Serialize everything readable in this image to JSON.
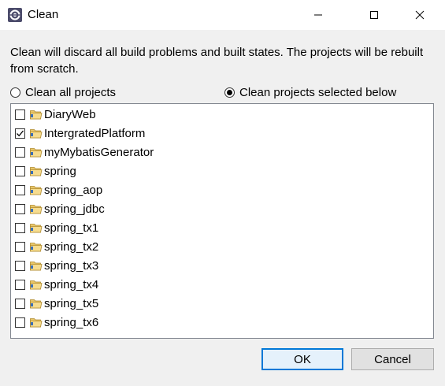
{
  "window": {
    "title": "Clean"
  },
  "description": "Clean will discard all build problems and built states.  The projects will be rebuilt from scratch.",
  "options": {
    "clean_all": {
      "label": "Clean all projects",
      "selected": false
    },
    "clean_selected": {
      "label": "Clean projects selected below",
      "selected": true
    }
  },
  "projects": [
    {
      "name": "DiaryWeb",
      "checked": false
    },
    {
      "name": "IntergratedPlatform",
      "checked": true
    },
    {
      "name": "myMybatisGenerator",
      "checked": false
    },
    {
      "name": "spring",
      "checked": false
    },
    {
      "name": "spring_aop",
      "checked": false
    },
    {
      "name": "spring_jdbc",
      "checked": false
    },
    {
      "name": "spring_tx1",
      "checked": false
    },
    {
      "name": "spring_tx2",
      "checked": false
    },
    {
      "name": "spring_tx3",
      "checked": false
    },
    {
      "name": "spring_tx4",
      "checked": false
    },
    {
      "name": "spring_tx5",
      "checked": false
    },
    {
      "name": "spring_tx6",
      "checked": false
    }
  ],
  "buttons": {
    "ok": "OK",
    "cancel": "Cancel"
  },
  "icons": {
    "app": "eclipse-icon",
    "folder": "project-folder-icon",
    "minimize": "minimize-icon",
    "maximize": "maximize-icon",
    "close": "close-icon"
  },
  "colors": {
    "accent": "#0078d7",
    "folder": "#e8c66a"
  }
}
